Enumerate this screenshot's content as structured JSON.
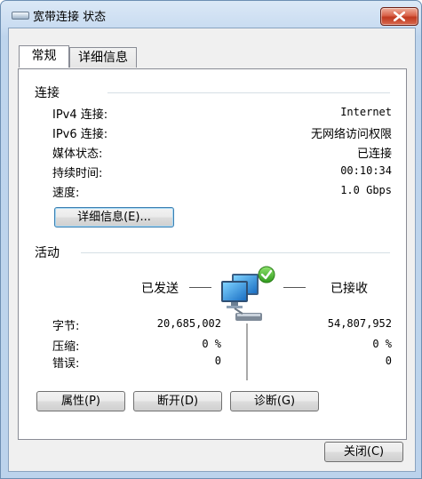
{
  "window": {
    "title": "宽带连接 状态",
    "icon": "modem-icon",
    "close_icon": "close-icon"
  },
  "tabs": [
    {
      "label": "常规",
      "selected": true
    },
    {
      "label": "详细信息",
      "selected": false
    }
  ],
  "connection": {
    "group_label": "连接",
    "rows": [
      {
        "label": "IPv4 连接:",
        "value": "Internet"
      },
      {
        "label": "IPv6 连接:",
        "value": "无网络访问权限"
      },
      {
        "label": "媒体状态:",
        "value": "已连接"
      },
      {
        "label": "持续时间:",
        "value": "00:10:34"
      },
      {
        "label": "速度:",
        "value": "1.0 Gbps"
      }
    ],
    "details_button": "详细信息(E)..."
  },
  "activity": {
    "group_label": "活动",
    "sent_label": "已发送",
    "received_label": "已接收",
    "icon": "network-computers-icon",
    "rows": [
      {
        "label": "字节:",
        "sent": "20,685,002",
        "received": "54,807,952"
      },
      {
        "label": "压缩:",
        "sent": "0 %",
        "received": "0 %"
      },
      {
        "label": "错误:",
        "sent": "0",
        "received": "0"
      }
    ]
  },
  "buttons": {
    "properties": "属性(P)",
    "disable": "断开(D)",
    "diagnose": "诊断(G)",
    "close": "关闭(C)"
  }
}
